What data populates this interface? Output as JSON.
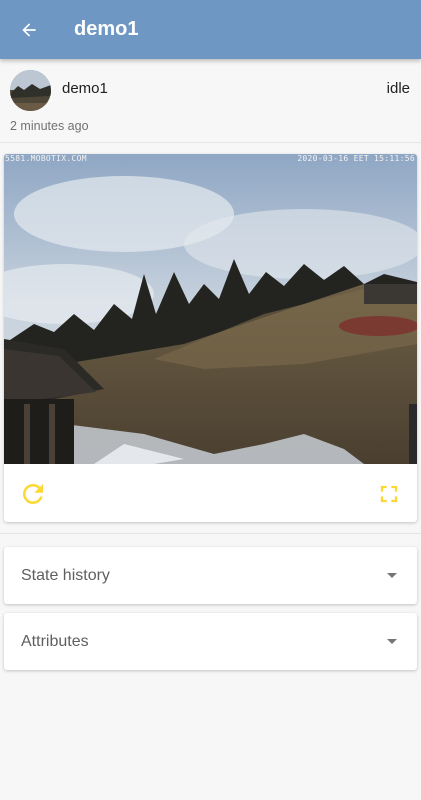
{
  "appbar": {
    "title": "demo1",
    "back_icon": "arrow-left-icon",
    "color": "#6e98c3"
  },
  "entity": {
    "name": "demo1",
    "state": "idle",
    "last_changed": "2 minutes ago"
  },
  "camera": {
    "overlay_left": "5581.MOBOTIX.COM",
    "overlay_right": "2020-03-16 EET 15:11:56",
    "refresh_icon": "refresh-icon",
    "fullscreen_icon": "fullscreen-icon",
    "action_color": "#fdd835"
  },
  "sections": [
    {
      "label": "State history"
    },
    {
      "label": "Attributes"
    }
  ]
}
